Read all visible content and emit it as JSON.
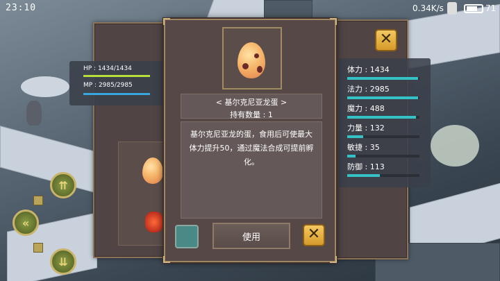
{
  "status_bar": {
    "time": "23:10",
    "network_speed": "0.34K/s",
    "battery_level": "71"
  },
  "vitals": {
    "hp_text": "HP : 1434/1434",
    "hp_fraction": 1.0,
    "hp_color": "#b6de3c",
    "mp_text": "MP : 2985/2985",
    "mp_fraction": 1.0,
    "mp_color": "#3aa6e0"
  },
  "stats": [
    {
      "label": "体力 : 1434",
      "fraction": 0.98
    },
    {
      "label": "法力 : 2985",
      "fraction": 0.98
    },
    {
      "label": "魔力 : 488",
      "fraction": 0.95
    },
    {
      "label": "力量 : 132",
      "fraction": 0.22
    },
    {
      "label": "敏捷 : 35",
      "fraction": 0.12
    },
    {
      "label": "防御 : 113",
      "fraction": 0.45
    }
  ],
  "item": {
    "icon": "dragon-egg-icon",
    "name": "< 基尔克尼亚龙蛋 >",
    "quantity": "持有数量 : 1",
    "description": "基尔克尼亚龙的蛋，食用后可使最大体力提升50，通过魔法合成可提前孵化。"
  },
  "buttons": {
    "use_label": "使用",
    "close_icon": "close-icon",
    "cancel_icon": "cancel-icon"
  },
  "colors": {
    "accent_gold": "#e0a93a",
    "stat_bar": "#35c2c6",
    "panel_brown": "#564846"
  }
}
